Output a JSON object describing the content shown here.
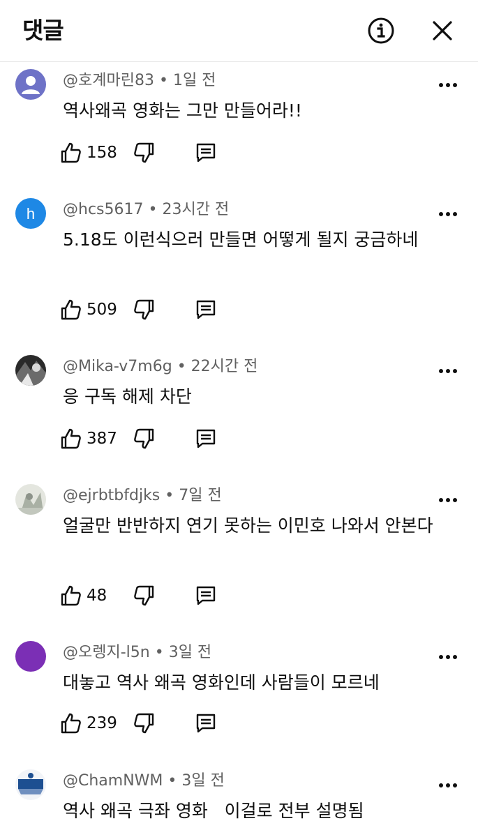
{
  "header": {
    "title": "댓글",
    "info_icon": "info-circle-icon",
    "close_icon": "close-icon"
  },
  "comments": [
    {
      "author": "@호계마린83",
      "time": "1일 전",
      "text": "역사왜곡 영화는 그만 만들어라!!",
      "likes": "158",
      "avatar": {
        "type": "default-user",
        "color": "#6e72c7"
      }
    },
    {
      "author": "@hcs5617",
      "time": "23시간 전",
      "text": "5.18도 이런식으러 만들면 어떻게 될지 궁금하네",
      "likes": "509",
      "avatar": {
        "type": "letter",
        "letter": "h",
        "color": "#1e88e5"
      }
    },
    {
      "author": "@Mika-v7m6g",
      "time": "22시간 전",
      "text": "응 구독 해제 차단",
      "likes": "387",
      "avatar": {
        "type": "photo",
        "color": "#3a3a3a"
      }
    },
    {
      "author": "@ejrbtbfdjks",
      "time": "7일 전",
      "text": "얼굴만 반반하지 연기 못하는 이민호 나와서 안본다",
      "likes": "48",
      "avatar": {
        "type": "photo",
        "color": "#c9ccc4"
      }
    },
    {
      "author": "@오렝지-l5n",
      "time": "3일 전",
      "text": "대놓고 역사 왜곡 영화인데 사람들이 모르네",
      "likes": "239",
      "avatar": {
        "type": "solid",
        "color": "#7b2fb5"
      }
    },
    {
      "author": "@ChamNWM",
      "time": "3일 전",
      "text": "역사 왜곡 극좌 영화   이걸로 전부 설명됨",
      "avatar": {
        "type": "logo",
        "color": "#1d4f91"
      }
    }
  ],
  "icons": {
    "like": "thumbs-up-icon",
    "dislike": "thumbs-down-icon",
    "reply": "reply-comment-icon",
    "more": "more-vertical-dots-icon"
  },
  "colors": {
    "text": "#0f0f0f",
    "meta": "#606060",
    "divider": "#e5e5e5"
  }
}
